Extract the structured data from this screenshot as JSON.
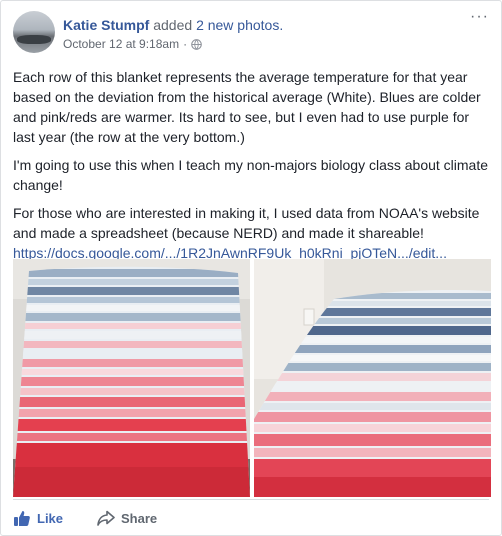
{
  "post": {
    "author": "Katie Stumpf",
    "action_prefix": "added",
    "action_link": "2 new photos.",
    "timestamp": "October 12 at 9:18am",
    "separator": "·",
    "privacy_icon": "globe-icon",
    "more_icon": "more-options-icon",
    "more_label": "···",
    "paragraphs": [
      "Each row of this blanket represents the average temperature for that year based on the deviation from the historical average (White). Blues are colder and pink/reds are warmer. Its hard to see, but I even had to use purple for last year (the row at the very bottom.)",
      "I'm going to use this when I teach my non-majors biology class about climate change!",
      "For those who are interested in making it, I used data from NOAA's website and made a spreadsheet (because NERD) and made it shareable!"
    ],
    "link": "https://docs.google.com/.../1R2JnAwnRF9Uk_h0kRni_pjOTeN.../edit..."
  },
  "actions": {
    "like_label": "Like",
    "share_label": "Share",
    "like_icon": "thumbs-up-icon",
    "share_icon": "share-arrow-icon"
  },
  "colors": {
    "link": "#365899",
    "like": "#4267b2",
    "muted": "#616770"
  }
}
